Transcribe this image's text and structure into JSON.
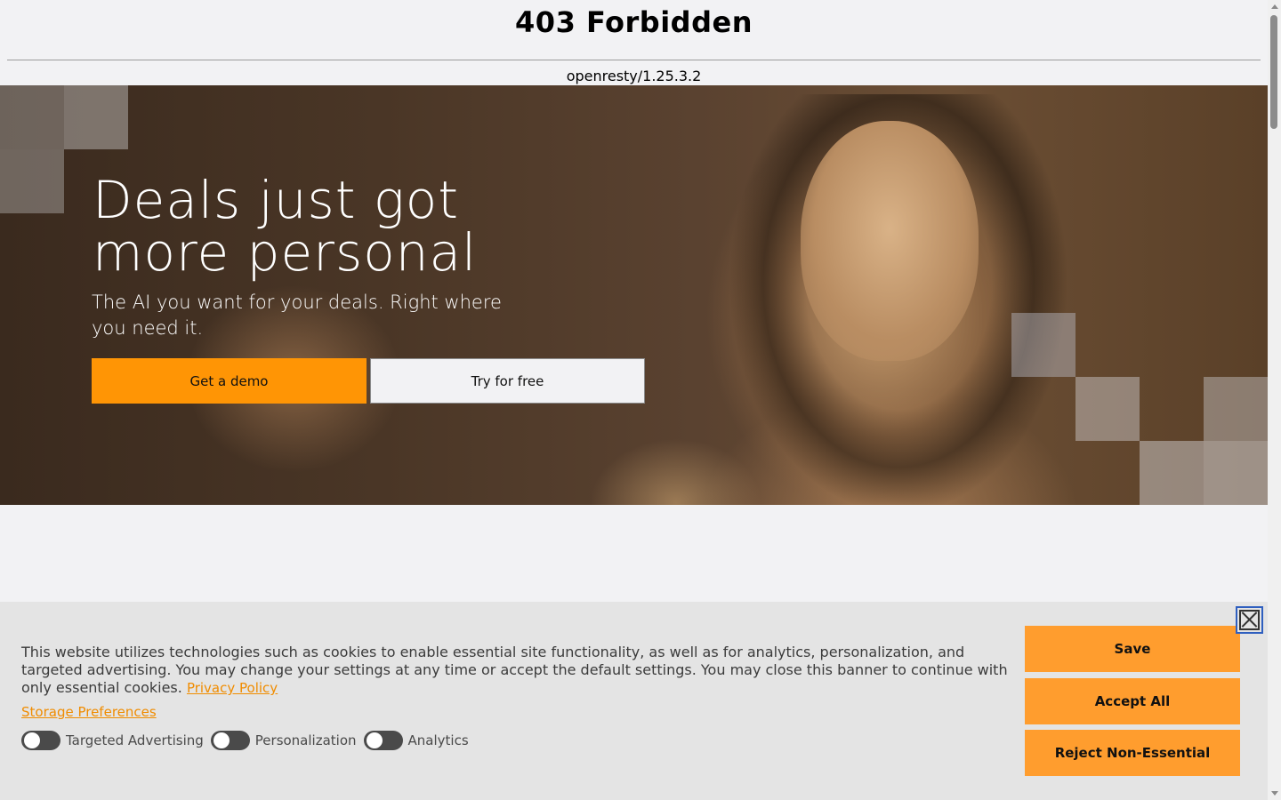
{
  "error_page": {
    "title": "403 Forbidden",
    "server": "openresty/1.25.3.2"
  },
  "hero": {
    "heading_line1": "Deals just got",
    "heading_line2": "more personal",
    "subheading": "The AI you want for your deals. Right where you need it.",
    "demo_button": "Get a demo",
    "free_button": "Try for free",
    "colors": {
      "primary_button": "#ff9505",
      "overlay": "#4a3626"
    }
  },
  "cookie_banner": {
    "text": "This website utilizes technologies such as cookies to enable essential site functionality, as well as for analytics, personalization, and targeted advertising. You may change your settings at any time or accept the default settings. You may close this banner to continue with only essential cookies.",
    "privacy_link": "Privacy Policy",
    "preferences_link": "Storage Preferences",
    "toggles": [
      {
        "label": "Targeted Advertising",
        "on": false
      },
      {
        "label": "Personalization",
        "on": false
      },
      {
        "label": "Analytics",
        "on": false
      }
    ],
    "buttons": {
      "save": "Save",
      "accept_all": "Accept All",
      "reject": "Reject Non-Essential"
    },
    "close_icon": "close-icon",
    "colors": {
      "button": "#ff9d2e",
      "link": "#f08c00",
      "background": "#e4e4e4"
    }
  }
}
